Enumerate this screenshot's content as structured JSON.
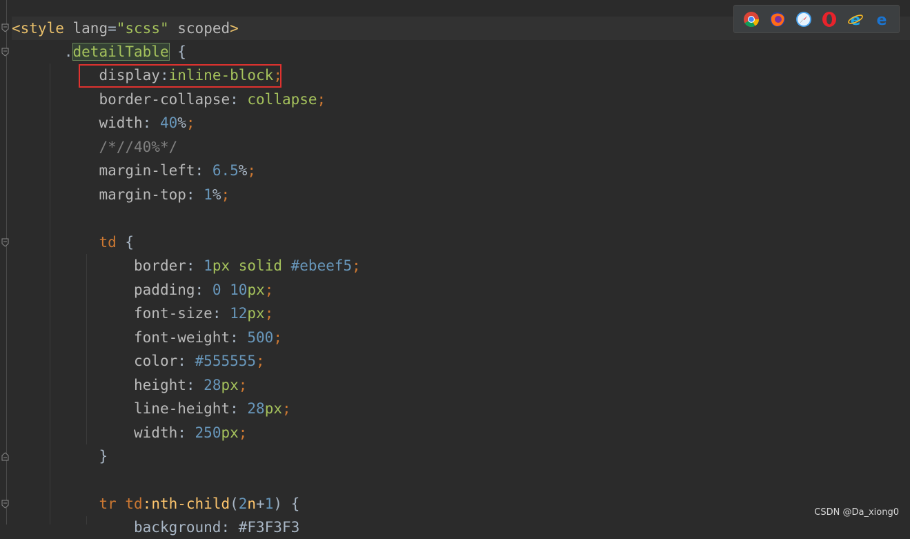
{
  "code": {
    "line1": {
      "open": "<style",
      "attr": "lang",
      "eq": "=",
      "value": "\"scss\"",
      "scoped": "scoped",
      "close": ">"
    },
    "line2": {
      "dot": ".",
      "class_name": "detailTable",
      "brace": " {"
    },
    "line3": {
      "prop": "display",
      "colon": ":",
      "value": "inline-block",
      "semi": ";"
    },
    "line4": {
      "prop": "border-collapse",
      "colon": ": ",
      "value": "collapse",
      "semi": ";"
    },
    "line5": {
      "prop": "width",
      "colon": ": ",
      "num": "40",
      "unit": "%",
      "semi": ";"
    },
    "line6": {
      "comment": "/*//40%*/"
    },
    "line7": {
      "prop": "margin-left",
      "colon": ": ",
      "num": "6.5",
      "unit": "%",
      "semi": ";"
    },
    "line8": {
      "prop": "margin-top",
      "colon": ": ",
      "num": "1",
      "unit": "%",
      "semi": ";"
    },
    "line10": {
      "selector": "td",
      "brace": " {"
    },
    "line11": {
      "prop": "border",
      "colon": ": ",
      "num": "1",
      "unit": "px",
      "val": " solid ",
      "hex": "#ebeef5",
      "semi": ";"
    },
    "line12": {
      "prop": "padding",
      "colon": ": ",
      "num": "0",
      "space": " ",
      "num2": "10",
      "unit": "px",
      "semi": ";"
    },
    "line13": {
      "prop": "font-size",
      "colon": ": ",
      "num": "12",
      "unit": "px",
      "semi": ";"
    },
    "line14": {
      "prop": "font-weight",
      "colon": ": ",
      "num": "500",
      "semi": ";"
    },
    "line15": {
      "prop": "color",
      "colon": ": ",
      "hex": "#555555",
      "semi": ";"
    },
    "line16": {
      "prop": "height",
      "colon": ": ",
      "num": "28",
      "unit": "px",
      "semi": ";"
    },
    "line17": {
      "prop": "line-height",
      "colon": ": ",
      "num": "28",
      "unit": "px",
      "semi": ";"
    },
    "line18": {
      "prop": "width",
      "colon": ": ",
      "num": "250",
      "unit": "px",
      "semi": ";"
    },
    "line19": {
      "brace": "}"
    },
    "line21": {
      "sel1": "tr",
      "sel2": " td",
      "pseudo": ":nth-child",
      "paren_open": "(",
      "num": "2",
      "n": "n",
      "plus": "+",
      "num2": "1",
      "paren_close": ")",
      "brace": " {"
    },
    "line22": {
      "partial": "background: #F3F3F3"
    }
  },
  "browser_icons": [
    "chrome-icon",
    "firefox-icon",
    "safari-icon",
    "opera-icon",
    "ie-icon",
    "edge-icon"
  ],
  "watermark": "CSDN @Da_xiong0",
  "colors": {
    "background": "#2b2b2b",
    "highlight_box": "#e0322f",
    "tag": "#e8bf6a",
    "string": "#a5c25c",
    "number": "#6897bb",
    "punctuation": "#cc7832",
    "comment": "#808080"
  }
}
